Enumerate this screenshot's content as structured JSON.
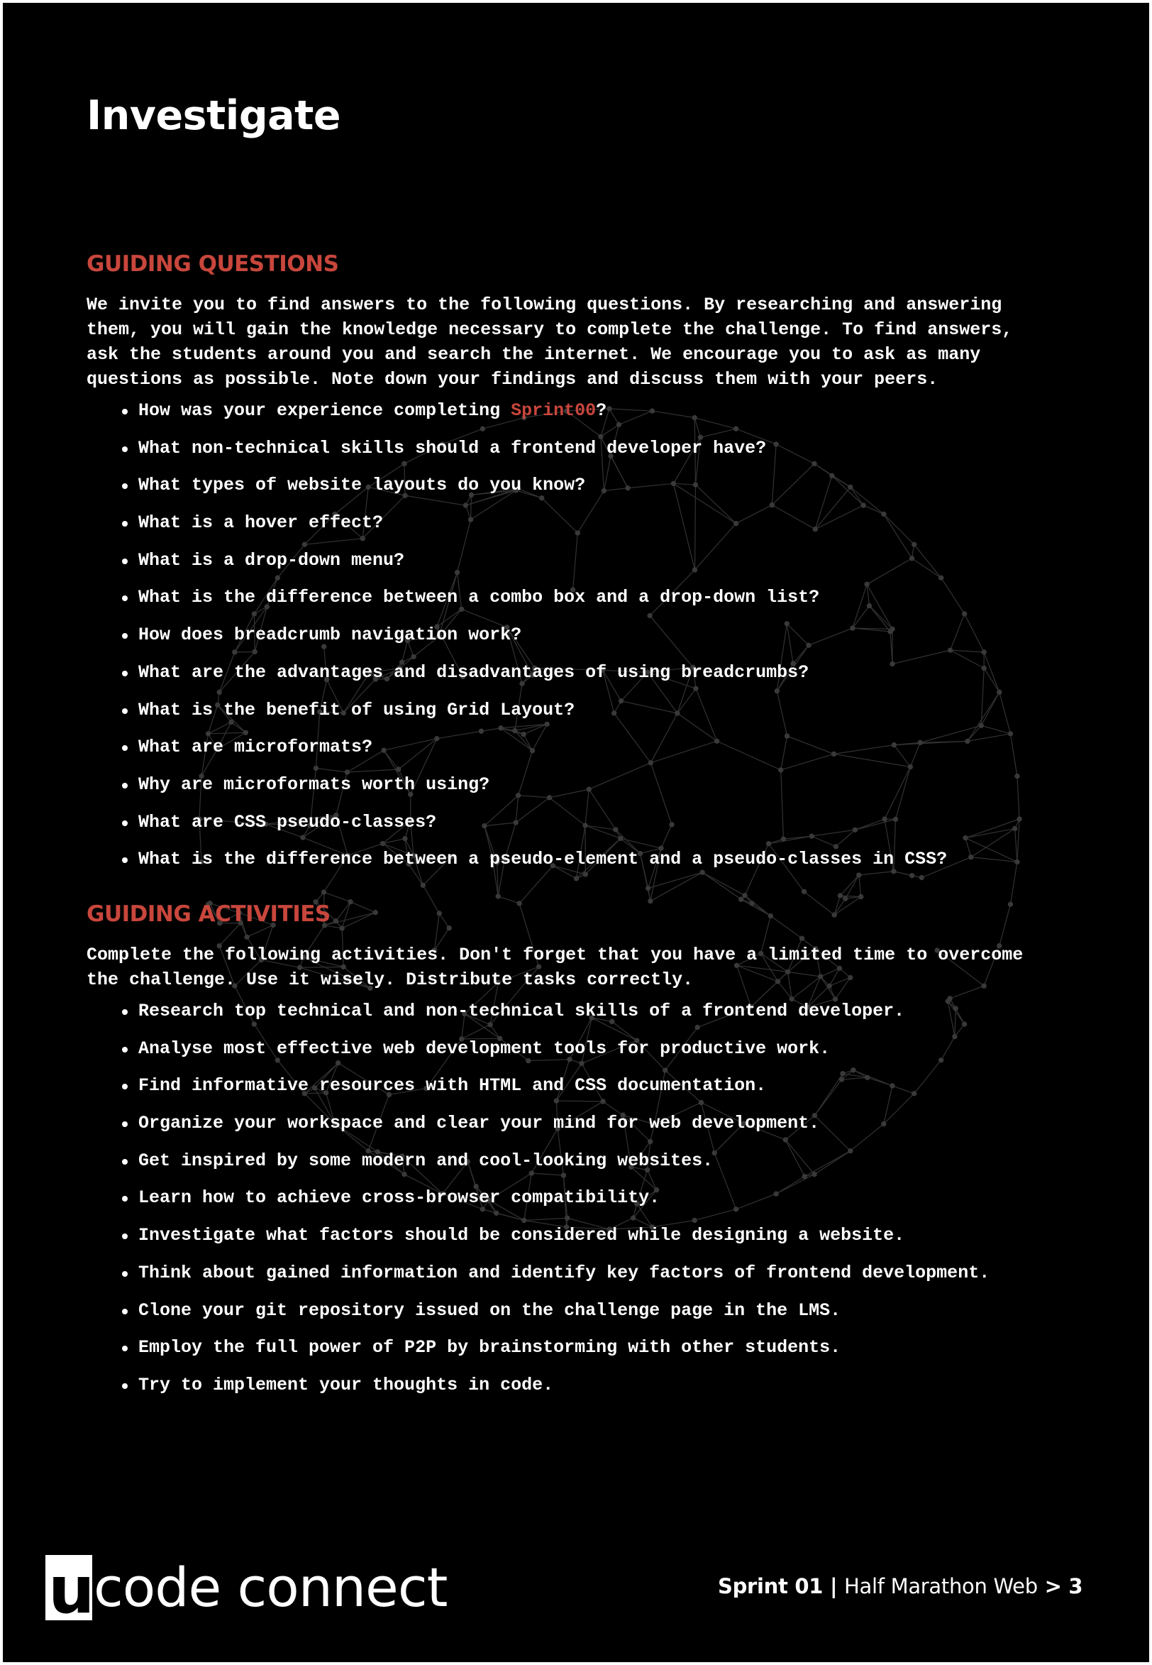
{
  "page": {
    "title": "Investigate"
  },
  "questions": {
    "heading": "GUIDING QUESTIONS",
    "intro": "We invite you to find answers to the following questions. By researching and answering\nthem, you will gain the knowledge necessary to complete the challenge. To find answers,\nask the students around you and search the internet. We encourage you to ask as many\nquestions as possible. Note down your findings and discuss them with your peers.",
    "first_item_prefix": "How was your experience completing ",
    "first_item_link": "Sprint00",
    "first_item_suffix": "?",
    "items": [
      "What non-technical skills should a frontend developer have?",
      "What types of website layouts do you know?",
      "What is a hover effect?",
      "What is a drop-down menu?",
      "What is the difference between a combo box and a drop-down list?",
      "How does breadcrumb navigation work?",
      "What are the advantages and disadvantages of using breadcrumbs?",
      "What is the benefit of using Grid Layout?",
      "What are microformats?",
      "Why are microformats worth using?",
      "What are CSS pseudo-classes?",
      "What is the difference between a pseudo-element and a pseudo-classes in CSS?"
    ]
  },
  "activities": {
    "heading": "GUIDING ACTIVITIES",
    "intro": "Complete the following activities. Don't forget that you have a limited time to overcome\nthe challenge. Use it wisely. Distribute tasks correctly.",
    "items": [
      "Research top technical and non-technical skills of a frontend developer.",
      "Analyse most effective web development tools for productive work.",
      "Find informative resources with HTML and CSS documentation.",
      "Organize your workspace and clear your mind for web development.",
      "Get inspired by some modern and cool-looking websites.",
      "Learn how to achieve cross-browser compatibility.",
      "Investigate what factors should be considered while designing a website.",
      "Think about gained information and identify key factors of frontend development.",
      "Clone your git repository issued on the challenge page in the LMS.",
      "Employ the full power of P2P by brainstorming with other students.",
      "Try to implement your thoughts in code."
    ]
  },
  "footer": {
    "logo_letter": "u",
    "logo_text": "code connect",
    "sprint": "Sprint 01",
    "separator": " | ",
    "course": "Half Marathon Web",
    "arrow": " > ",
    "page_number": "3"
  },
  "colors": {
    "background": "#000000",
    "accent": "#c8463c",
    "text": "#ffffff"
  }
}
